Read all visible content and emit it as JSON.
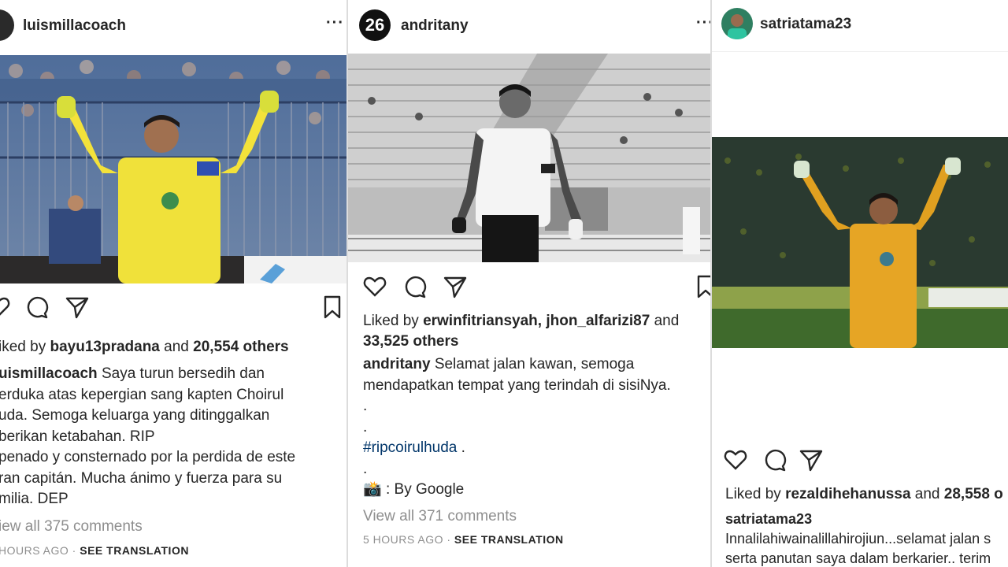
{
  "posts": [
    {
      "username": "luismillacoach",
      "likes_prefix": "iked by",
      "liker": "bayu13pradana",
      "likes_mid": "and",
      "likes_count": "20,554 others",
      "caption_user": "uismillacoach",
      "caption_lines": [
        "Saya turun bersedih dan",
        "erduka atas kepergian sang kapten Choirul",
        "uda. Semoga keluarga yang ditinggalkan",
        "berikan ketabahan. RIP",
        "penado y consternado por la perdida de este",
        "ran capitán. Mucha ánimo y fuerza para su",
        "milia. DEP"
      ],
      "view_comments": "iew all 375 comments",
      "time": "HOURS AGO",
      "translate": "SEE TRANSLATION"
    },
    {
      "username": "andritany",
      "avatar_text": "26",
      "likes_prefix": "Liked by",
      "liker": "erwinfitriansyah, jhon_alfarizi87",
      "likes_mid": "and",
      "likes_count": "33,525 others",
      "caption_user": "andritany",
      "caption_lines": [
        "Selamat jalan kawan, semoga",
        "mendapatkan tempat yang terindah di sisiNya.",
        ".",
        ".",
        "#ripcoirulhuda",
        ".",
        "By Google"
      ],
      "view_comments": "View all 371 comments",
      "time": "5 HOURS AGO",
      "translate": "SEE TRANSLATION"
    },
    {
      "username": "satriatama23",
      "likes_prefix": "Liked by",
      "liker": "rezaldihehanussa",
      "likes_mid": "and",
      "likes_count": "28,558 o",
      "caption_user": "satriatama23",
      "caption_lines": [
        "Innalilahiwainalillahirojiun...selamat jalan s",
        "serta panutan saya dalam berkarier.. terim"
      ]
    }
  ]
}
